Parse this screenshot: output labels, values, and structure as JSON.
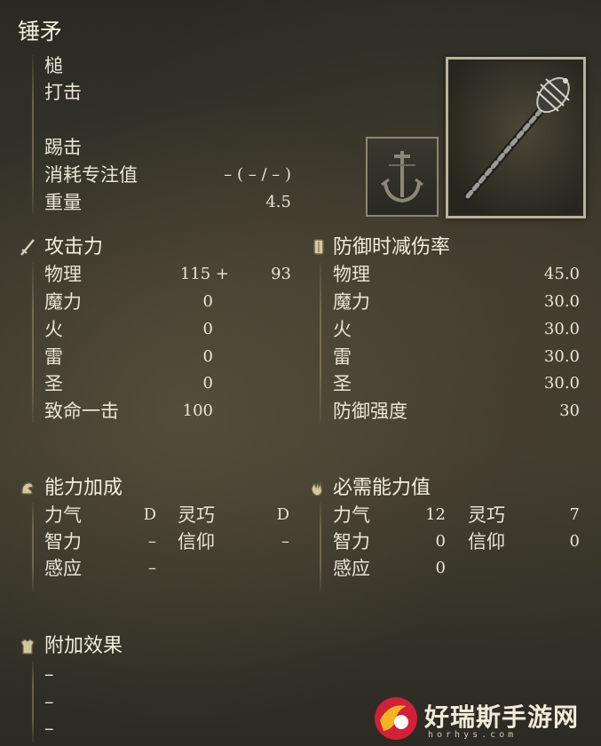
{
  "weapon_name": "锤矛",
  "info": {
    "type": "槌",
    "attack_type": "打击",
    "skill": "踢击",
    "fp_cost_label": "消耗专注值",
    "fp_cost_value": "– (   – /   – )",
    "weight_label": "重量",
    "weight_value": "4.5"
  },
  "attack": {
    "title": "攻击力",
    "rows": [
      {
        "label": "物理",
        "base": "115 +",
        "bonus": "93"
      },
      {
        "label": "魔力",
        "base": "0",
        "bonus": ""
      },
      {
        "label": "火",
        "base": "0",
        "bonus": ""
      },
      {
        "label": "雷",
        "base": "0",
        "bonus": ""
      },
      {
        "label": "圣",
        "base": "0",
        "bonus": ""
      },
      {
        "label": "致命一击",
        "base": "100",
        "bonus": ""
      }
    ]
  },
  "guard": {
    "title": "防御时减伤率",
    "rows": [
      {
        "label": "物理",
        "value": "45.0"
      },
      {
        "label": "魔力",
        "value": "30.0"
      },
      {
        "label": "火",
        "value": "30.0"
      },
      {
        "label": "雷",
        "value": "30.0"
      },
      {
        "label": "圣",
        "value": "30.0"
      },
      {
        "label": "防御强度",
        "value": "30"
      }
    ]
  },
  "scaling": {
    "title": "能力加成",
    "str_label": "力气",
    "str_value": "D",
    "dex_label": "灵巧",
    "dex_value": "D",
    "int_label": "智力",
    "int_value": "–",
    "fai_label": "信仰",
    "fai_value": "–",
    "arc_label": "感应",
    "arc_value": "–"
  },
  "requirements": {
    "title": "必需能力值",
    "str_label": "力气",
    "str_value": "12",
    "dex_label": "灵巧",
    "dex_value": "7",
    "int_label": "智力",
    "int_value": "0",
    "fai_label": "信仰",
    "fai_value": "0",
    "arc_label": "感应",
    "arc_value": "0"
  },
  "passive": {
    "title": "附加效果",
    "items": [
      "–",
      "–",
      "–"
    ]
  },
  "watermark": {
    "text": "好瑞斯手游网",
    "sub": "horhys.com"
  },
  "icons": {
    "attack": "sword-icon",
    "guard": "shield-icon",
    "scaling": "arm-icon",
    "requirements": "hand-icon",
    "passive": "armor-icon",
    "skill": "anchor-crest-icon",
    "weapon": "mace-icon"
  }
}
